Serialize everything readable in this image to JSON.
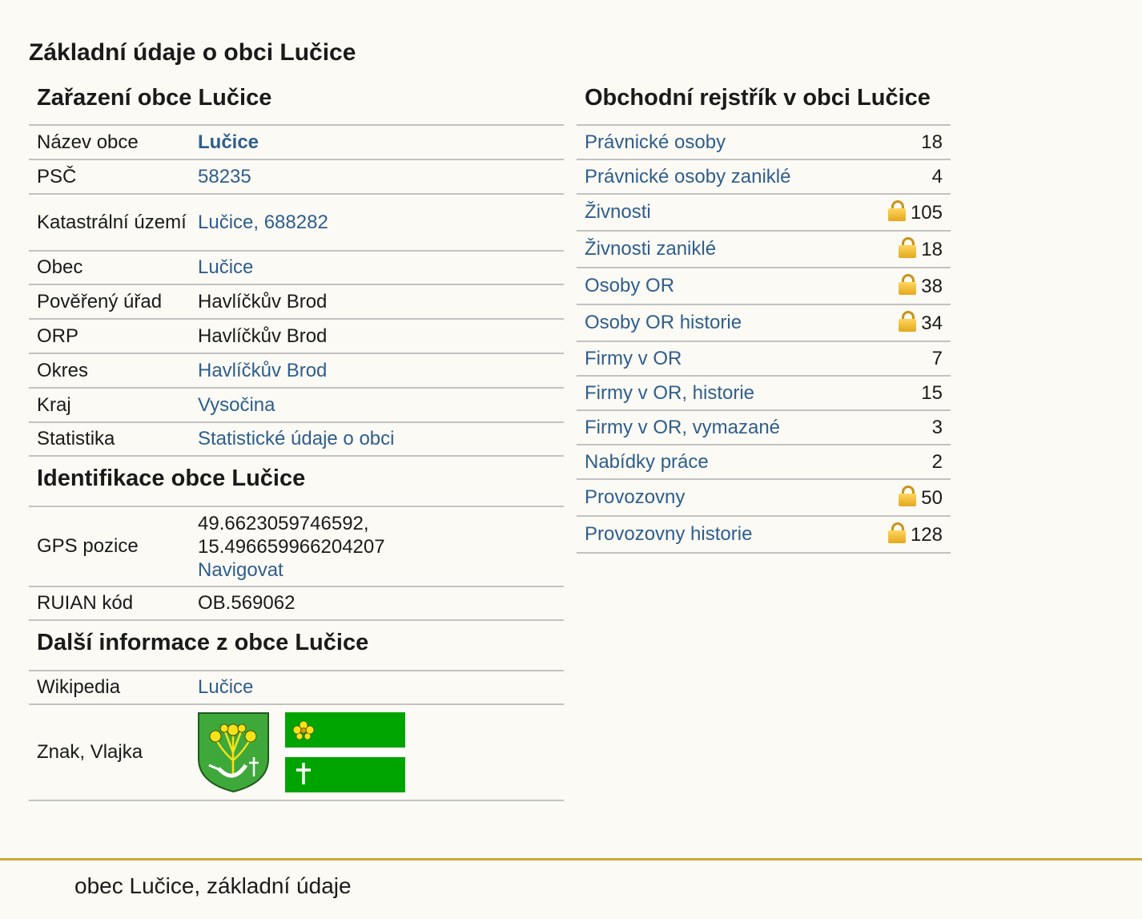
{
  "page_title": "Základní údaje o obci Lučice",
  "zarazeni": {
    "title": "Zařazení obce Lučice",
    "rows": {
      "nazev": {
        "label": "Název obce",
        "value": "Lučice"
      },
      "psc": {
        "label": "PSČ",
        "value": "58235"
      },
      "katastr": {
        "label": "Katastrální území",
        "value": "Lučice, 688282"
      },
      "obec": {
        "label": "Obec",
        "value": "Lučice"
      },
      "poverene": {
        "label": "Pověřený úřad",
        "value": "Havlíčkův Brod"
      },
      "orp": {
        "label": "ORP",
        "value": "Havlíčkův Brod"
      },
      "okres": {
        "label": "Okres",
        "value": "Havlíčkův Brod"
      },
      "kraj": {
        "label": "Kraj",
        "value": "Vysočina"
      },
      "statistika": {
        "label": "Statistika",
        "value": "Statistické údaje o obci"
      }
    }
  },
  "identifikace": {
    "title": "Identifikace obce Lučice",
    "gps": {
      "label": "GPS pozice",
      "lat": "49.6623059746592,",
      "lon": "15.496659966204207",
      "navigate": "Navigovat"
    },
    "ruian": {
      "label": "RUIAN kód",
      "value": "OB.569062"
    }
  },
  "dalsi": {
    "title": "Další informace z obce Lučice",
    "wikipedia": {
      "label": "Wikipedia",
      "value": "Lučice"
    },
    "znak": {
      "label": "Znak, Vlajka"
    }
  },
  "rejstrik": {
    "title": "Obchodní rejstřík v obci Lučice",
    "items": [
      {
        "label": "Právnické osoby",
        "count": "18",
        "locked": false
      },
      {
        "label": "Právnické osoby zaniklé",
        "count": "4",
        "locked": false
      },
      {
        "label": "Živnosti",
        "count": "105",
        "locked": true
      },
      {
        "label": "Živnosti zaniklé",
        "count": "18",
        "locked": true
      },
      {
        "label": "Osoby OR",
        "count": "38",
        "locked": true
      },
      {
        "label": "Osoby OR historie",
        "count": "34",
        "locked": true
      },
      {
        "label": "Firmy v OR",
        "count": "7",
        "locked": false
      },
      {
        "label": "Firmy v OR, historie",
        "count": "15",
        "locked": false
      },
      {
        "label": "Firmy v OR, vymazané",
        "count": "3",
        "locked": false
      },
      {
        "label": "Nabídky práce",
        "count": "2",
        "locked": false
      },
      {
        "label": "Provozovny",
        "count": "50",
        "locked": true
      },
      {
        "label": "Provozovny historie",
        "count": "128",
        "locked": true
      }
    ]
  },
  "footer": {
    "text": "obec Lučice, základní údaje"
  },
  "colors": {
    "link": "#2f5e8c",
    "flag_green": "#00a400",
    "shield_green": "#3fa83a",
    "flower_yellow": "#f5e21a",
    "lock_gold": "#e3a81e",
    "footer_line": "#d4a833"
  },
  "icons": {
    "lock": "lock-icon",
    "coat_of_arms": "coat-of-arms-image",
    "flag": "flag-image"
  }
}
